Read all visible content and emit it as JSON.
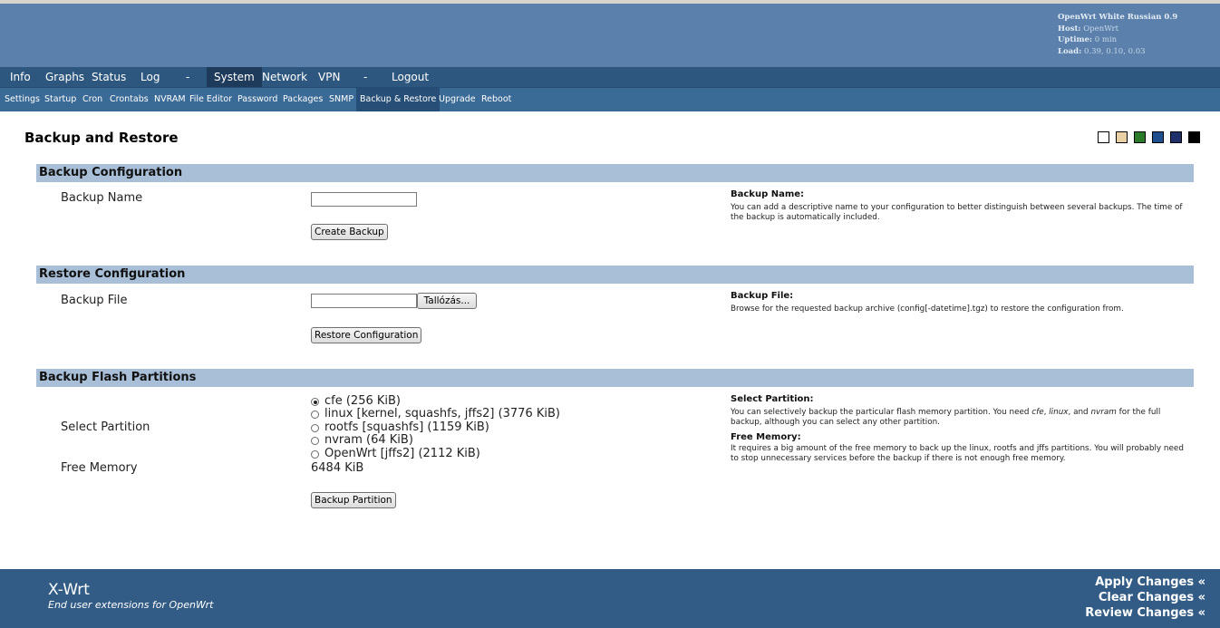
{
  "header": {
    "title": "OpenWrt White Russian 0.9",
    "host_label": "Host:",
    "host_value": "OpenWrt",
    "uptime_label": "Uptime:",
    "uptime_value": "0 min",
    "load_label": "Load:",
    "load_value": "0.39, 0.10, 0.03"
  },
  "main_nav": [
    {
      "label": "Info"
    },
    {
      "label": "Graphs"
    },
    {
      "label": "Status"
    },
    {
      "label": "Log"
    },
    {
      "label": "-"
    },
    {
      "label": "System",
      "active": true
    },
    {
      "label": "Network"
    },
    {
      "label": "VPN"
    },
    {
      "label": "-"
    },
    {
      "label": "Logout"
    }
  ],
  "sub_nav": [
    {
      "label": "Settings"
    },
    {
      "label": "Startup"
    },
    {
      "label": "Cron"
    },
    {
      "label": "Crontabs"
    },
    {
      "label": "NVRAM"
    },
    {
      "label": "File Editor"
    },
    {
      "label": "Password"
    },
    {
      "label": "Packages"
    },
    {
      "label": "SNMP"
    },
    {
      "label": "Backup & Restore",
      "active": true
    },
    {
      "label": "Upgrade"
    },
    {
      "label": "Reboot"
    }
  ],
  "page": {
    "title": "Backup and Restore"
  },
  "theme_swatches": [
    "#ffffff",
    "#e8cfa5",
    "#2a7a2a",
    "#1f4f8f",
    "#1f2f6a",
    "#000000"
  ],
  "backup_config": {
    "heading": "Backup Configuration",
    "name_label": "Backup Name",
    "name_value": "",
    "create_button": "Create Backup",
    "help_title": "Backup Name:",
    "help_text": "You can add a descriptive name to your configuration to better distinguish between several backups. The time of the backup is automatically included."
  },
  "restore_config": {
    "heading": "Restore Configuration",
    "file_label": "Backup File",
    "browse_button": "Tallózás...",
    "restore_button": "Restore Configuration",
    "help_title": "Backup File:",
    "help_text": "Browse for the requested backup archive (config[-datetime].tgz) to restore the configuration from."
  },
  "flash": {
    "heading": "Backup Flash Partitions",
    "select_label": "Select Partition",
    "partitions": [
      {
        "label": "cfe (256 KiB)",
        "checked": true
      },
      {
        "label": "linux [kernel, squashfs, jffs2] (3776 KiB)",
        "checked": false
      },
      {
        "label": "rootfs [squashfs] (1159 KiB)",
        "checked": false
      },
      {
        "label": "nvram (64 KiB)",
        "checked": false
      },
      {
        "label": "OpenWrt [jffs2] (2112 KiB)",
        "checked": false
      }
    ],
    "free_mem_label": "Free Memory",
    "free_mem_value": "6484 KiB",
    "backup_button": "Backup Partition",
    "help_select_title": "Select Partition:",
    "help_select_text_1": "You can selectively backup the particular flash memory partition. You need ",
    "help_select_cfe": "cfe",
    "help_select_sep1": ", ",
    "help_select_linux": "linux",
    "help_select_sep2": ", and ",
    "help_select_nvram": "nvram",
    "help_select_text_2": " for the full backup, although you can select any other partition.",
    "help_free_title": "Free Memory:",
    "help_free_text": "It requires a big amount of the free memory to back up the linux, rootfs and jffs partitions. You will probably need to stop unnecessary services before the backup if there is not enough free memory."
  },
  "footer": {
    "brand": "X-Wrt",
    "tagline": "End user extensions for OpenWrt",
    "apply": "Apply Changes «",
    "clear": "Clear Changes «",
    "review": "Review Changes «"
  }
}
